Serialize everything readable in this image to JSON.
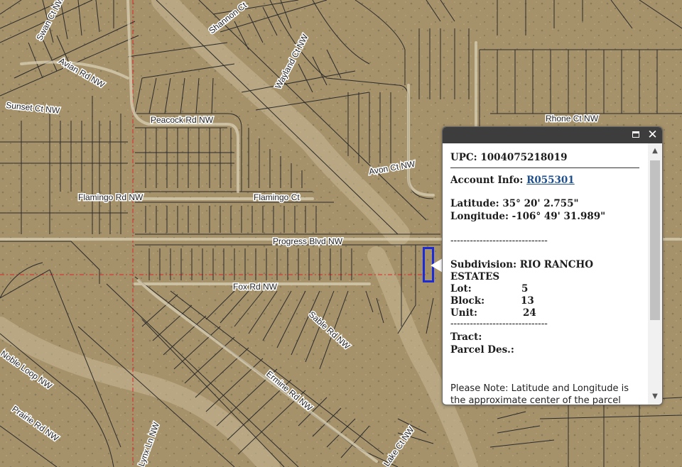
{
  "map": {
    "roads": {
      "swan": "Swan Ct NW",
      "shannon": "Shannon Ct",
      "avian": "Avian Rd NW",
      "sunset": "Sunset Ct NW",
      "peacock": "Peacock Rd NW",
      "wayland": "Wayland Ct NW",
      "rhone": "Rhone Ct NW",
      "avon": "Avon Ct NW",
      "flamingo_rd": "Flamingo Rd NW",
      "flamingo_ct": "Flamingo Ct",
      "progress": "Progress Blvd NW",
      "fox": "Fox Rd NW",
      "sable": "Sable Rd NW",
      "ermine": "Ermine Rd NW",
      "noble": "Noble Loop NW",
      "prairie": "Prairie Rd NW",
      "lynx": "Lynx Ln NW",
      "lake": "Lake Ct NW"
    },
    "colors": {
      "terrain": "#a5916a",
      "parcel_line": "#2b2b2b",
      "grid_line": "#e0272a",
      "highlight": "#1b2bd8"
    }
  },
  "popup": {
    "upc_label": "UPC:",
    "upc_value": "1004075218019",
    "account_label": "Account Info:",
    "account_value": "R055301",
    "latitude_label": "Latitude:",
    "latitude_value": "35° 20' 2.755\"",
    "longitude_label": "Longitude:",
    "longitude_value": "-106° 49' 31.989\"",
    "separator": "------------------------------",
    "subdivision_label": "Subdivision:",
    "subdivision_value_1": "RIO RANCHO",
    "subdivision_value_2": "ESTATES",
    "lot_label": "Lot:",
    "lot_value": "5",
    "block_label": "Block:",
    "block_value": "13",
    "unit_label": "Unit:",
    "unit_value": "24",
    "tract_label": "Tract:",
    "parcel_des_label": "Parcel Des.:",
    "note": "Please Note: Latitude and Longitude is the approximate center of the parcel shown."
  }
}
